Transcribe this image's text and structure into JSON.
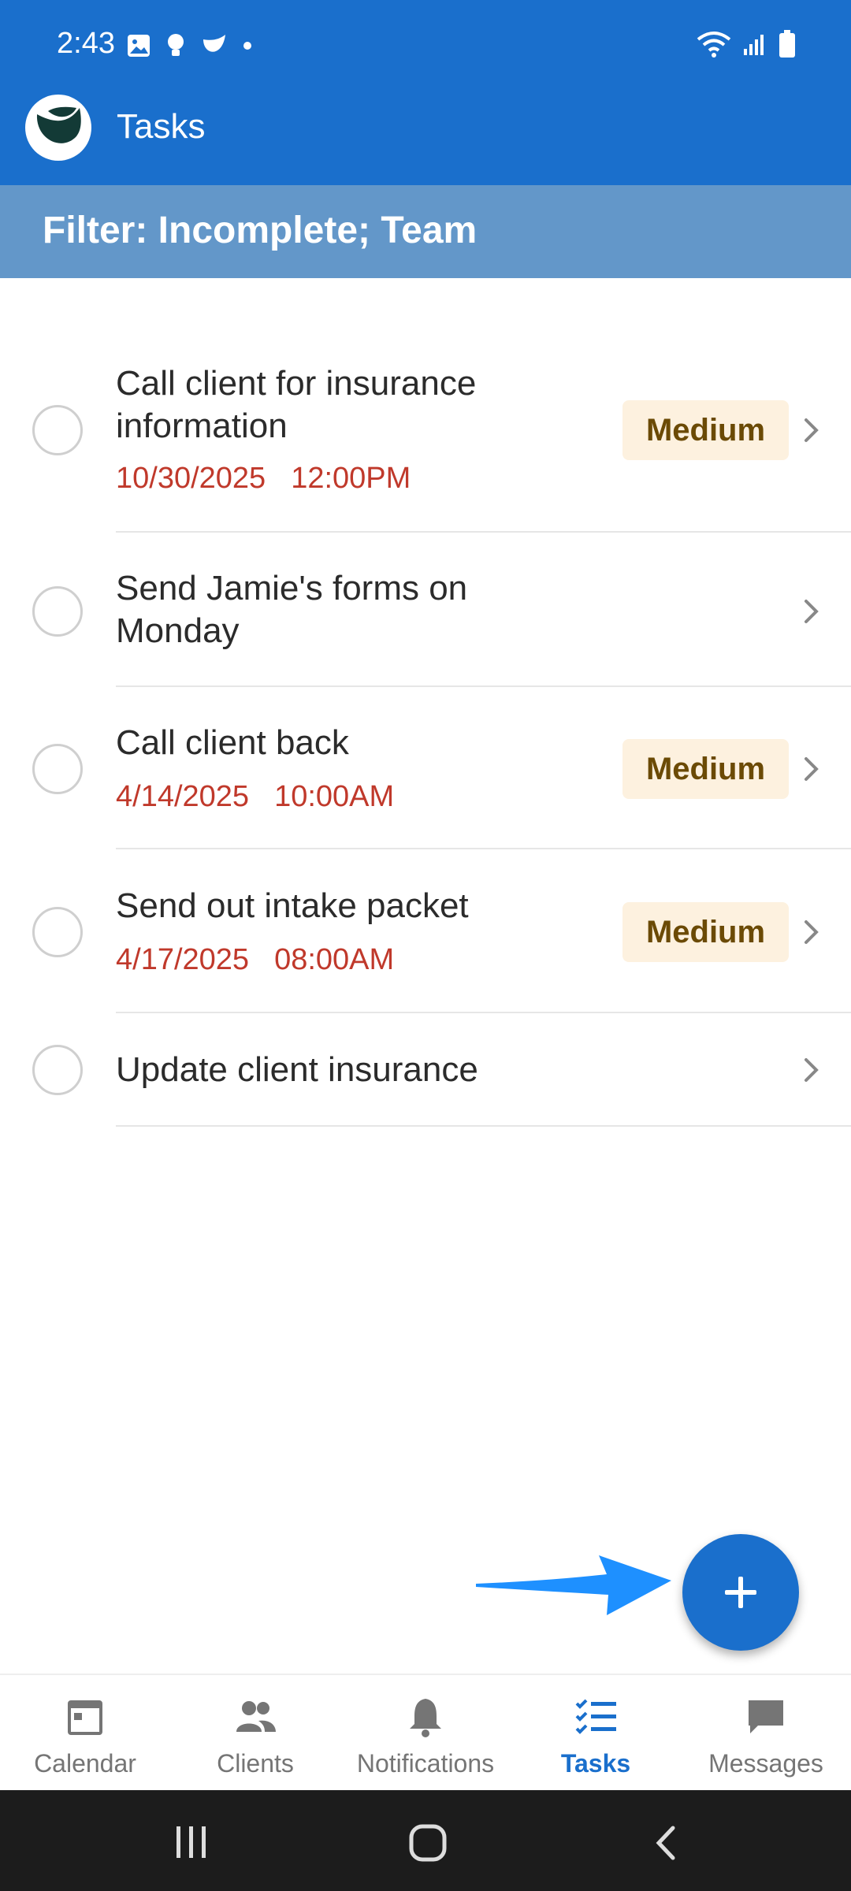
{
  "status_bar": {
    "time": "2:43"
  },
  "app_bar": {
    "title": "Tasks"
  },
  "filter": {
    "text": "Filter: Incomplete; Team"
  },
  "tasks": [
    {
      "title": "Call client for insurance information",
      "date": "10/30/2025",
      "time": "12:00PM",
      "priority": "Medium"
    },
    {
      "title": "Send Jamie's forms on Monday",
      "date": "",
      "time": "",
      "priority": ""
    },
    {
      "title": "Call client back",
      "date": "4/14/2025",
      "time": "10:00AM",
      "priority": "Medium"
    },
    {
      "title": "Send out intake packet",
      "date": "4/17/2025",
      "time": "08:00AM",
      "priority": "Medium"
    },
    {
      "title": "Update client insurance",
      "date": "",
      "time": "",
      "priority": ""
    }
  ],
  "fab": {
    "icon": "plus-icon"
  },
  "bottom_nav": {
    "items": [
      {
        "label": "Calendar",
        "icon": "calendar-icon",
        "active": false
      },
      {
        "label": "Clients",
        "icon": "people-icon",
        "active": false
      },
      {
        "label": "Notifications",
        "icon": "bell-icon",
        "active": false
      },
      {
        "label": "Tasks",
        "icon": "tasks-list-icon",
        "active": true
      },
      {
        "label": "Messages",
        "icon": "message-icon",
        "active": false
      }
    ]
  },
  "colors": {
    "primary": "#1a6fcc",
    "filter_bar": "#6397c9",
    "date_red": "#c0392b",
    "badge_bg": "#fdf1df",
    "badge_text": "#6b4a05",
    "annotation_arrow": "#1e90ff"
  }
}
